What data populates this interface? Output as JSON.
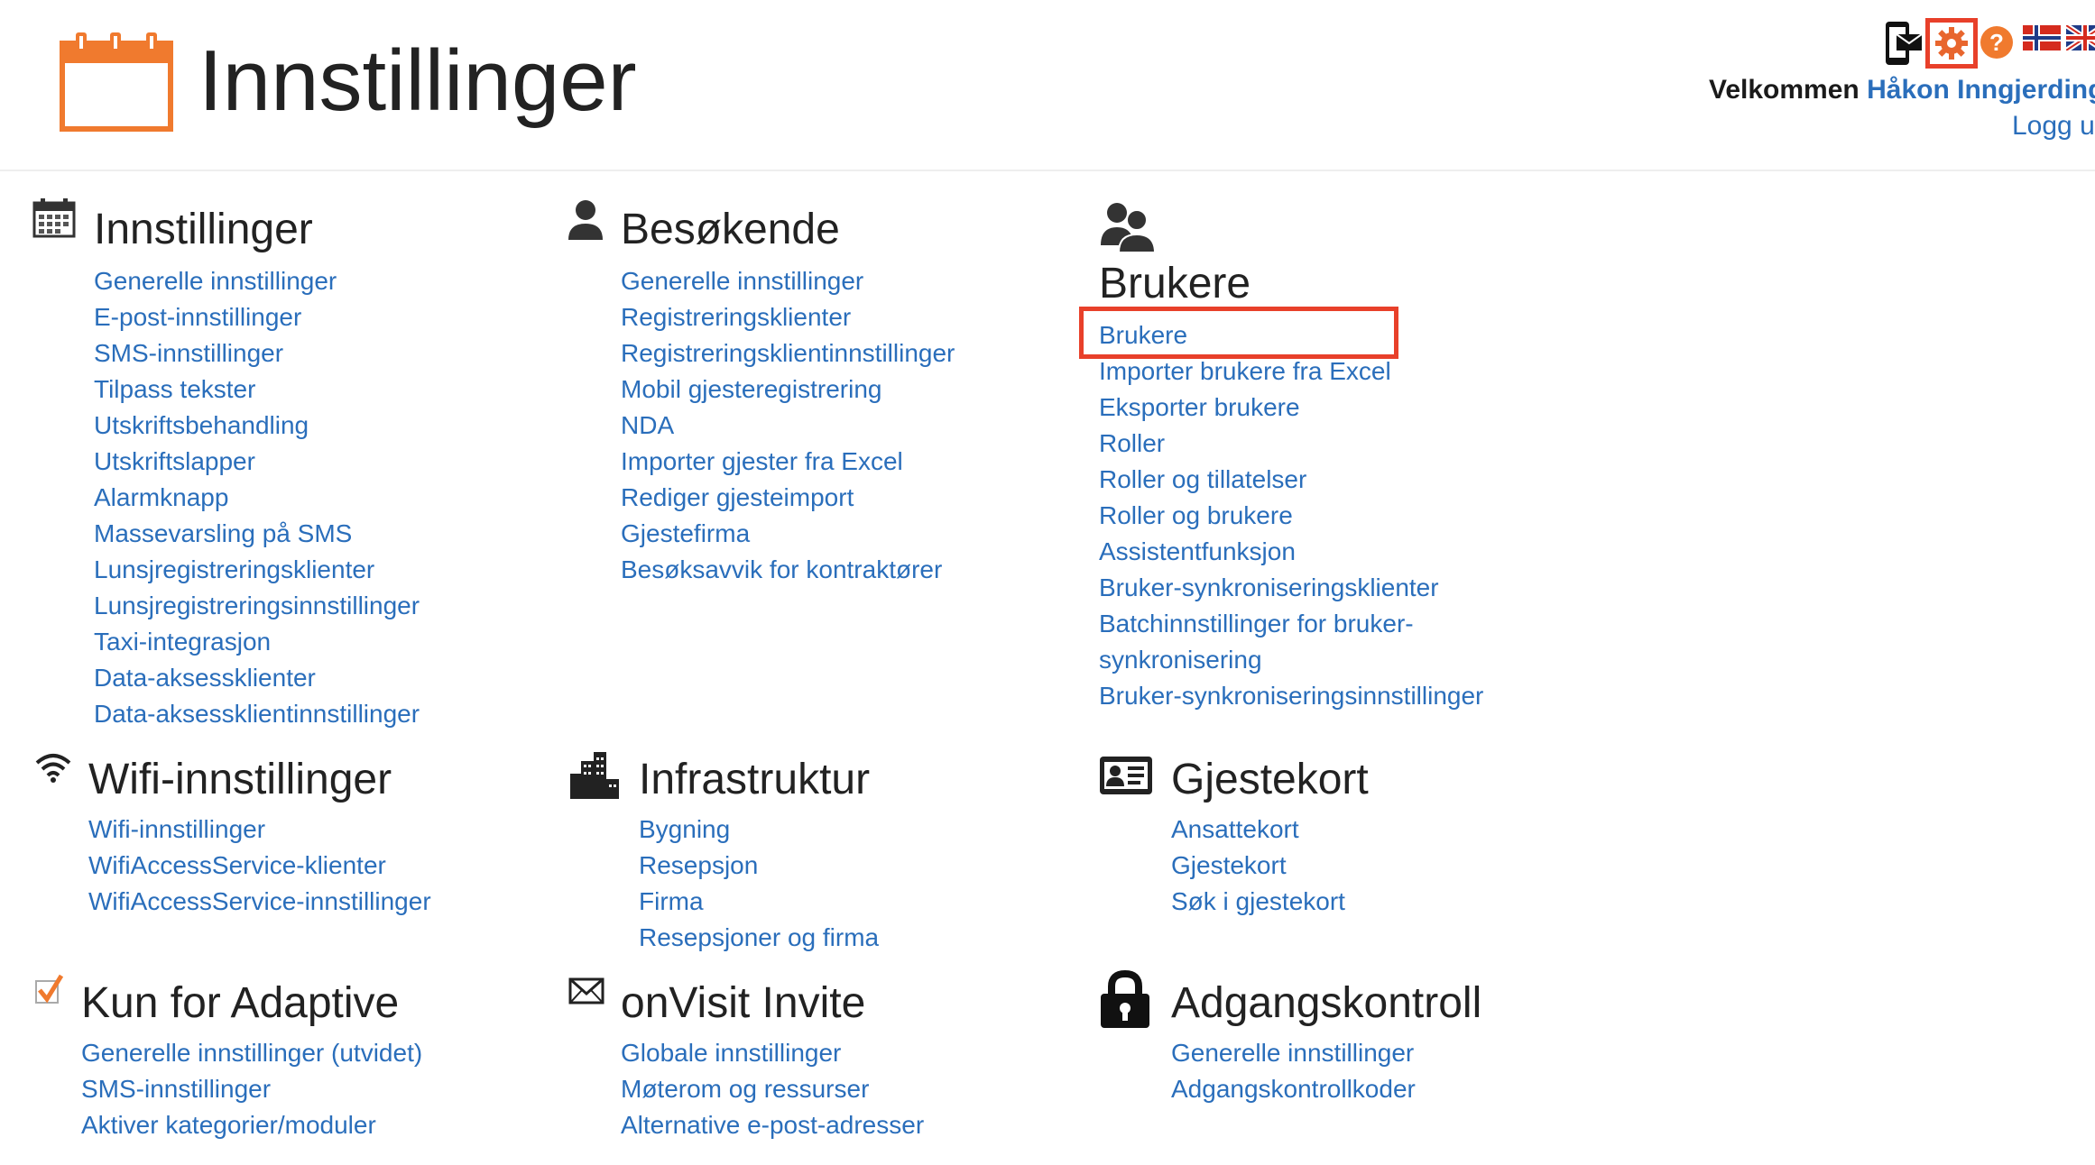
{
  "header": {
    "title": "Innstillinger",
    "welcome_label": "Velkommen",
    "user_name": "Håkon Inngjerdinge",
    "logout_label": "Logg u"
  },
  "colors": {
    "accent_orange": "#f07a2e",
    "link_blue": "#2a6ebb",
    "highlight_red": "#e8402a"
  },
  "icons": {
    "page": "calendar-icon",
    "toolbar": [
      "phone-icon",
      "gear-icon",
      "help-icon",
      "norway-flag-icon",
      "uk-flag-icon"
    ]
  },
  "sections": {
    "innstillinger": {
      "title": "Innstillinger",
      "icon": "calendar-icon",
      "items": [
        "Generelle innstillinger",
        "E-post-innstillinger",
        "SMS-innstillinger",
        "Tilpass tekster",
        "Utskriftsbehandling",
        "Utskriftslapper",
        "Alarmknapp",
        "Massevarsling på SMS",
        "Lunsjregistreringsklienter",
        "Lunsjregistreringsinnstillinger",
        "Taxi-integrasjon",
        "Data-aksessklienter",
        "Data-aksessklientinnstillinger"
      ]
    },
    "besokende": {
      "title": "Besøkende",
      "icon": "person-icon",
      "items": [
        "Generelle innstillinger",
        "Registreringsklienter",
        "Registreringsklientinnstillinger",
        "Mobil gjesteregistrering",
        "NDA",
        "Importer gjester fra Excel",
        "Rediger gjesteimport",
        "Gjestefirma",
        "Besøksavvik for kontraktører"
      ]
    },
    "brukere": {
      "title": "Brukere",
      "icon": "users-icon",
      "items": [
        "Brukere",
        "Importer brukere fra Excel",
        "Eksporter brukere",
        "Roller",
        "Roller og tillatelser",
        "Roller og brukere",
        "Assistentfunksjon",
        "Bruker-synkroniseringsklienter",
        "Batchinnstillinger for bruker-synkronisering",
        "Bruker-synkroniseringsinnstillinger"
      ]
    },
    "wifi": {
      "title": "Wifi-innstillinger",
      "icon": "wifi-icon",
      "items": [
        "Wifi-innstillinger",
        "WifiAccessService-klienter",
        "WifiAccessService-innstillinger"
      ]
    },
    "infrastruktur": {
      "title": "Infrastruktur",
      "icon": "buildings-icon",
      "items": [
        "Bygning",
        "Resepsjon",
        "Firma",
        "Resepsjoner og firma"
      ]
    },
    "gjestekort": {
      "title": "Gjestekort",
      "icon": "id-card-icon",
      "items": [
        "Ansattekort",
        "Gjestekort",
        "Søk i gjestekort"
      ]
    },
    "adaptive": {
      "title": "Kun for Adaptive",
      "icon": "checkbox-icon",
      "items": [
        "Generelle innstillinger (utvidet)",
        "SMS-innstillinger",
        "Aktiver kategorier/moduler"
      ]
    },
    "invite": {
      "title": "onVisit Invite",
      "icon": "envelope-icon",
      "items": [
        "Globale innstillinger",
        "Møterom og ressurser",
        "Alternative e-post-adresser"
      ]
    },
    "adgang": {
      "title": "Adgangskontroll",
      "icon": "lock-icon",
      "items": [
        "Generelle innstillinger",
        "Adgangskontrollkoder"
      ]
    }
  }
}
